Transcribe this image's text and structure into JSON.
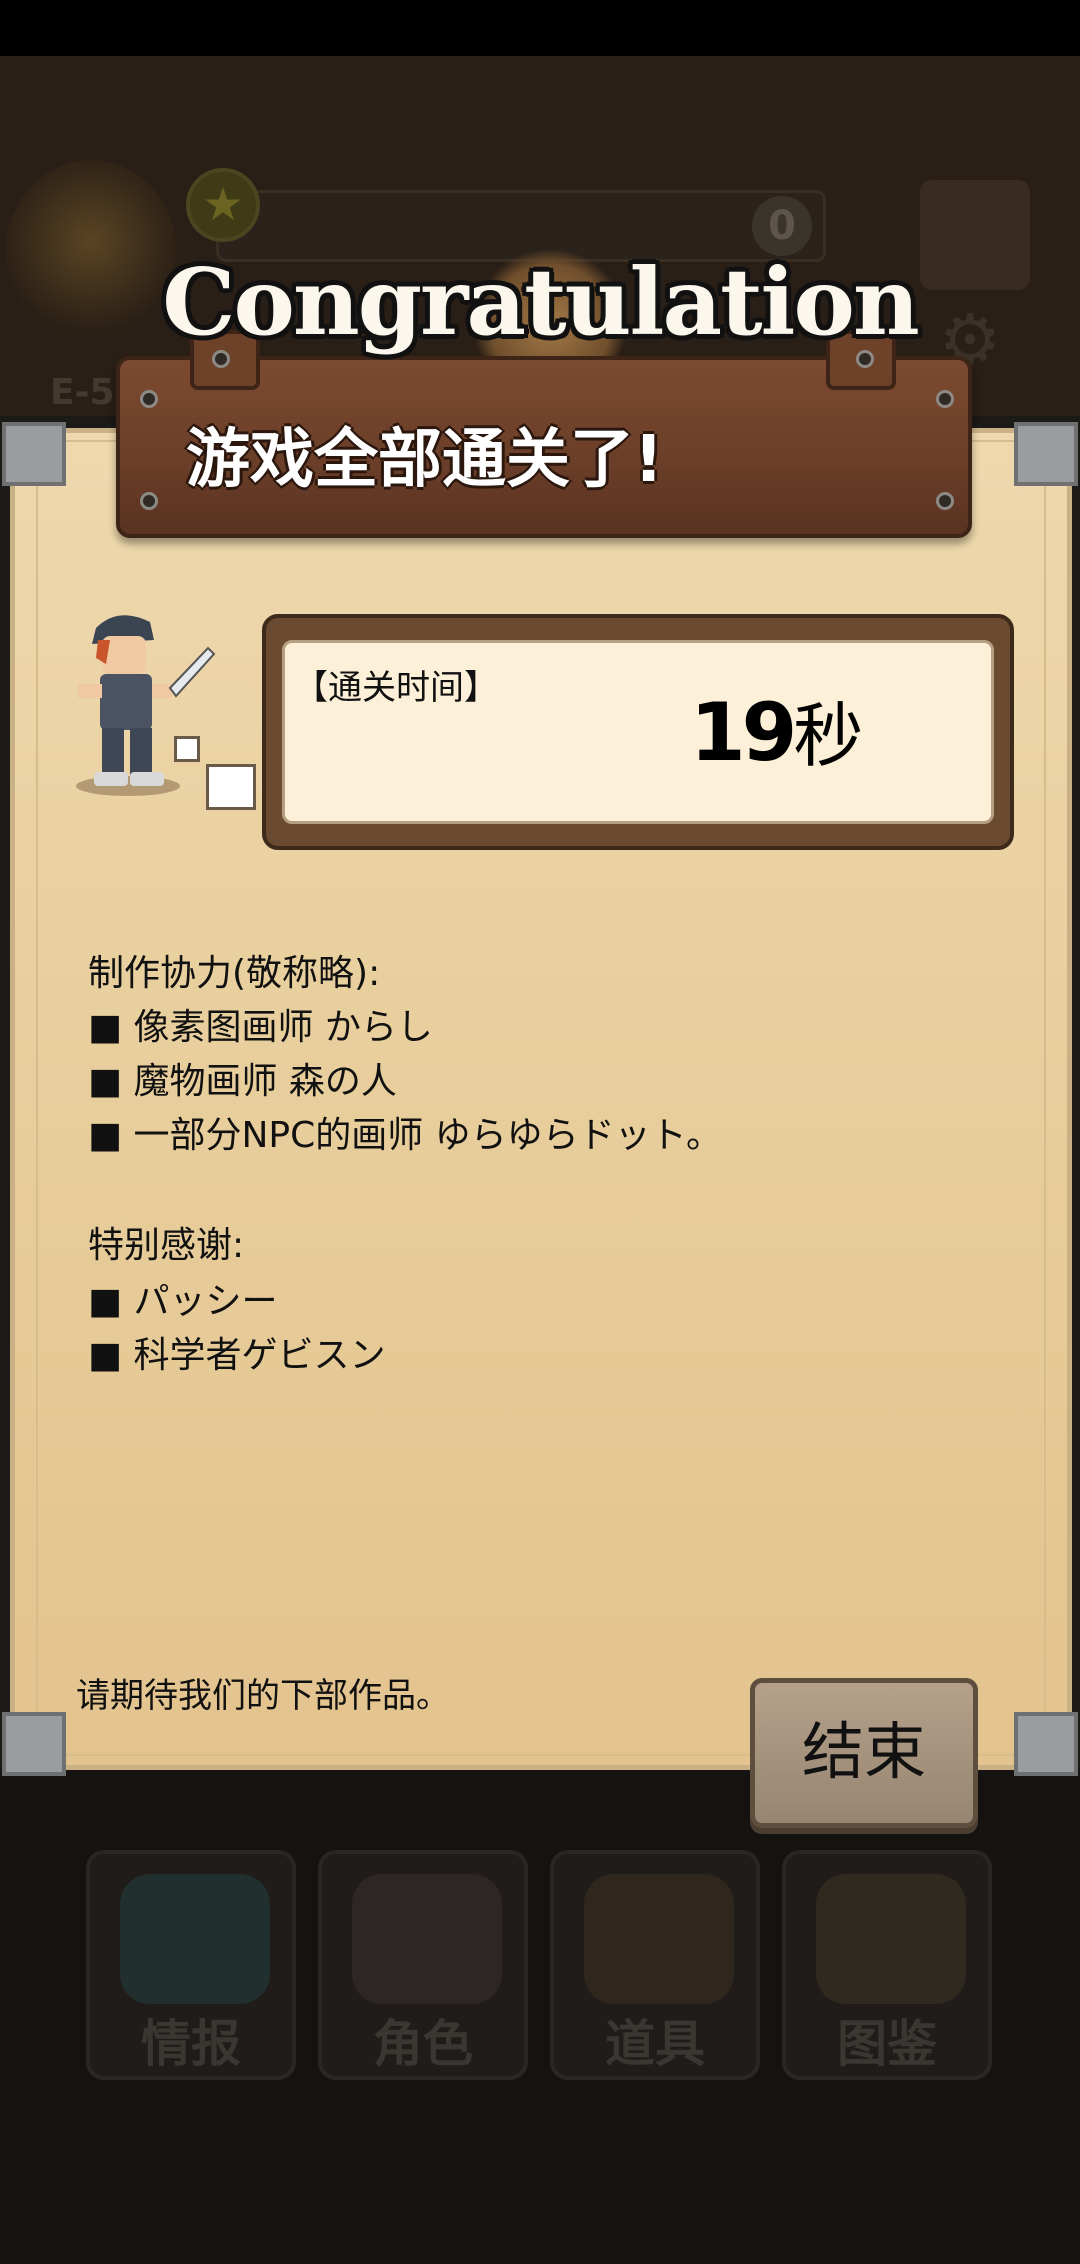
{
  "background": {
    "counter": "0",
    "stage": "E-5",
    "nav": [
      {
        "label": "情报",
        "icon": "info-icon"
      },
      {
        "label": "角色",
        "icon": "character-icon"
      },
      {
        "label": "道具",
        "icon": "chest-icon"
      },
      {
        "label": "图鉴",
        "icon": "book-icon"
      }
    ]
  },
  "dialog": {
    "banner": "Congratulation",
    "subtitle": "游戏全部通关了!",
    "time_label": "【通关时间】",
    "time_value": "19",
    "time_unit": "秒",
    "credits": [
      "制作协力(敬称略):",
      "■ 像素图画师 からし",
      "■ 魔物画师 森の人",
      "■ 一部分NPC的画师 ゆらゆらドット。",
      "",
      "特别感谢:",
      "■ パッシー",
      "■ 科学者ゲビスン"
    ],
    "footer": "请期待我们的下部作品。",
    "end_button": "结束"
  }
}
